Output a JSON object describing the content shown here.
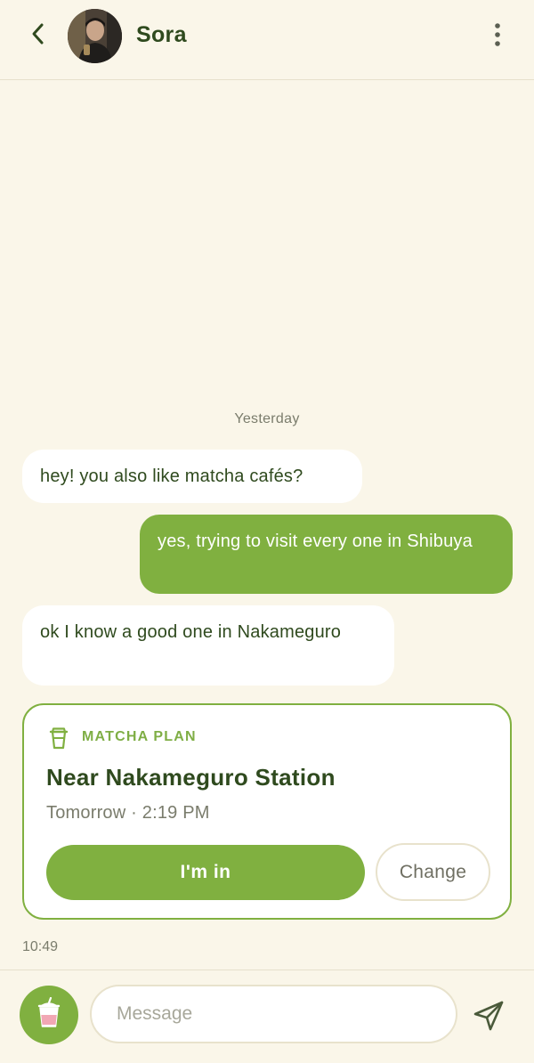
{
  "header": {
    "contact_name": "Sora",
    "back_icon": "chevron-left-icon",
    "more_icon": "more-vertical-icon"
  },
  "chat": {
    "day_label": "Yesterday",
    "messages": [
      {
        "direction": "in",
        "text": "hey! you also like matcha cafés?"
      },
      {
        "direction": "out",
        "text": "yes, trying to visit every one in Shibuya"
      },
      {
        "direction": "in",
        "text": "ok I know a good one in Nakameguro"
      }
    ],
    "plan_card": {
      "icon": "cup-icon",
      "tag": "MATCHA PLAN",
      "title": "Near Nakameguro Station",
      "time": "Tomorrow · 2:19 PM",
      "accept_label": "I'm in",
      "change_label": "Change"
    },
    "last_time": "10:49"
  },
  "composer": {
    "placeholder": "Message",
    "value": "",
    "drink_icon": "bubble-tea-icon",
    "send_icon": "send-icon"
  },
  "colors": {
    "background": "#faf6e9",
    "accent": "#80b040",
    "text": "#2f4a1e",
    "muted": "#7a7c6c"
  }
}
